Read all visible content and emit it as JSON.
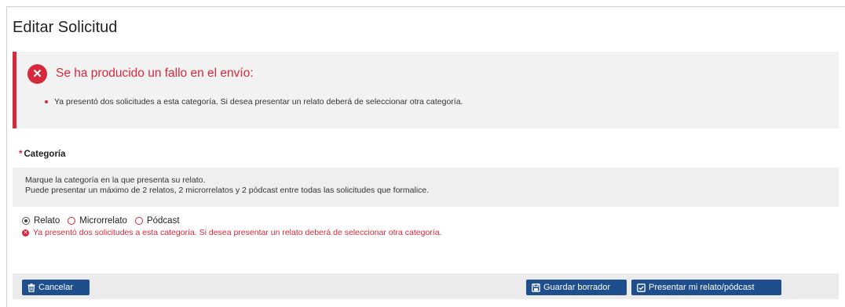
{
  "page": {
    "title": "Editar Solicitud"
  },
  "error_box": {
    "heading": "Se ha producido un fallo en el envío:",
    "icon": "error-circle-icon",
    "items": [
      "Ya presentó dos solicitudes a esta categoría. Si desea presentar un relato deberá de seleccionar otra categoría."
    ]
  },
  "category": {
    "required_mark": "*",
    "label": "Categoría",
    "help_line_1": "Marque la categoría en la que presenta su relato.",
    "help_line_2": "Puede presentar un máximo de 2 relatos, 2 microrrelatos y 2 pódcast entre todas las solicitudes que formalice.",
    "options": [
      {
        "label": "Relato",
        "selected": true
      },
      {
        "label": "Microrrelato",
        "selected": false
      },
      {
        "label": "Pódcast",
        "selected": false
      }
    ],
    "error": "Ya presentó dos solicitudes a esta categoría. Si desea presentar un relato deberá de seleccionar otra categoría."
  },
  "footer": {
    "cancel_label": "Cancelar",
    "draft_label": "Guardar borrador",
    "submit_label": "Presentar mi relato/pódcast"
  },
  "colors": {
    "error_red": "#d6293b",
    "button_blue": "#1f4e8c",
    "panel_gray": "#f2f2f2"
  }
}
